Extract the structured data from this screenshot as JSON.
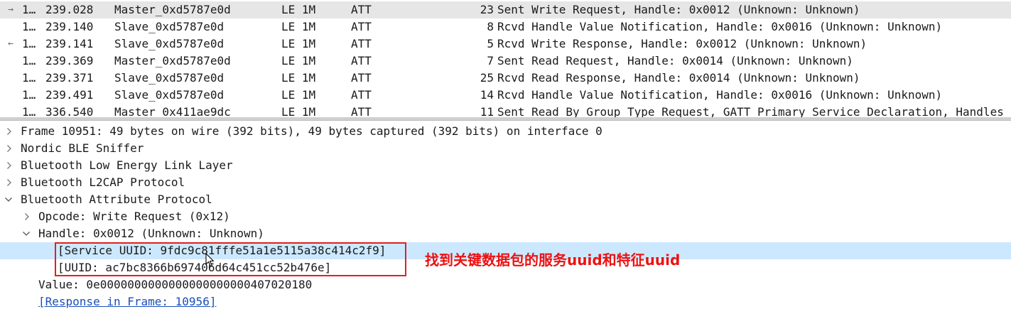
{
  "packet_list": {
    "rows": [
      {
        "arrow": "→",
        "arrow_icon": "request-arrow-icon",
        "no": "1…",
        "time": "239.028",
        "source": "Master_0xd5787e0d",
        "phy": "LE 1M",
        "protocol": "ATT",
        "length": "23",
        "info": "Sent Write Request, Handle: 0x0012 (Unknown: Unknown)",
        "selected": true
      },
      {
        "arrow": "",
        "arrow_icon": "",
        "no": "1…",
        "time": "239.140",
        "source": "Slave_0xd5787e0d",
        "phy": "LE 1M",
        "protocol": "ATT",
        "length": "8",
        "info": "Rcvd Handle Value Notification, Handle: 0x0016 (Unknown: Unknown)",
        "selected": false
      },
      {
        "arrow": "←",
        "arrow_icon": "response-arrow-icon",
        "no": "1…",
        "time": "239.141",
        "source": "Slave_0xd5787e0d",
        "phy": "LE 1M",
        "protocol": "ATT",
        "length": "5",
        "info": "Rcvd Write Response, Handle: 0x0012 (Unknown: Unknown)",
        "selected": false
      },
      {
        "arrow": "",
        "arrow_icon": "",
        "no": "1…",
        "time": "239.369",
        "source": "Master_0xd5787e0d",
        "phy": "LE 1M",
        "protocol": "ATT",
        "length": "7",
        "info": "Sent Read Request, Handle: 0x0014 (Unknown: Unknown)",
        "selected": false
      },
      {
        "arrow": "",
        "arrow_icon": "",
        "no": "1…",
        "time": "239.371",
        "source": "Slave_0xd5787e0d",
        "phy": "LE 1M",
        "protocol": "ATT",
        "length": "25",
        "info": "Rcvd Read Response, Handle: 0x0014 (Unknown: Unknown)",
        "selected": false
      },
      {
        "arrow": "",
        "arrow_icon": "",
        "no": "1…",
        "time": "239.491",
        "source": "Slave_0xd5787e0d",
        "phy": "LE 1M",
        "protocol": "ATT",
        "length": "14",
        "info": "Rcvd Handle Value Notification, Handle: 0x0016 (Unknown: Unknown)",
        "selected": false
      },
      {
        "arrow": "",
        "arrow_icon": "",
        "no": "1…",
        "time": "336.540",
        "source": "Master_0x411ae9dc",
        "phy": "LE 1M",
        "protocol": "ATT",
        "length": "11",
        "info": "Sent Read By Group Type Request, GATT Primary Service Declaration, Handles",
        "selected": false
      }
    ]
  },
  "detail_tree": {
    "frame": "Frame 10951: 49 bytes on wire (392 bits), 49 bytes captured (392 bits) on interface 0",
    "sniffer": "Nordic BLE Sniffer",
    "link_layer": "Bluetooth Low Energy Link Layer",
    "l2cap": "Bluetooth L2CAP Protocol",
    "att": "Bluetooth Attribute Protocol",
    "opcode": "Opcode: Write Request (0x12)",
    "handle": "Handle: 0x0012 (Unknown: Unknown)",
    "service_uuid": "[Service UUID: 9fdc9c81fffe51a1e5115a38c414c2f9]",
    "uuid": "[UUID: ac7bc8366b697406d64c451cc52b476e]",
    "value": "Value: 0e0000000000000000000000407020180",
    "response_link": "[Response in Frame: 10956]"
  },
  "annotation": {
    "text": "找到关键数据包的服务uuid和特征uuid",
    "color": "#ee1111"
  },
  "colors": {
    "selected_row": "#e6e6e6",
    "highlight_row": "#cce8ff",
    "link": "#1a4fb8"
  }
}
